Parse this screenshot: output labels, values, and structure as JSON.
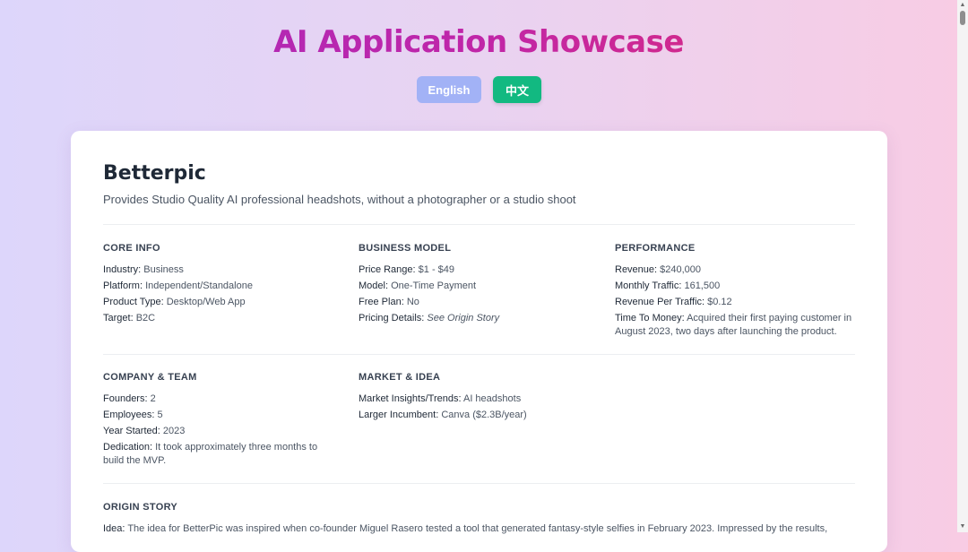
{
  "header": {
    "title": "AI Application Showcase",
    "lang_buttons": [
      "English",
      "中文"
    ],
    "colors": {
      "title_gradient_start": "#a42bc0",
      "title_gradient_end": "#e52d6d",
      "english": "#a2b2f6",
      "chinese": "#12b981"
    }
  },
  "app": {
    "name": "Betterpic",
    "description": "Provides Studio Quality AI professional headshots, without a photographer or a studio shoot"
  },
  "core_info": {
    "heading": "CORE INFO",
    "rows": [
      {
        "key": "Industry:",
        "value": "Business"
      },
      {
        "key": "Platform:",
        "value": "Independent/Standalone"
      },
      {
        "key": "Product Type:",
        "value": "Desktop/Web App"
      },
      {
        "key": "Target:",
        "value": "B2C"
      }
    ]
  },
  "business_model": {
    "heading": "BUSINESS MODEL",
    "rows": [
      {
        "key": "Price Range:",
        "value": "$1 - $49"
      },
      {
        "key": "Model:",
        "value": "One-Time Payment"
      },
      {
        "key": "Free Plan:",
        "value": "No"
      },
      {
        "key": "Pricing Details:",
        "value": "See Origin Story"
      }
    ]
  },
  "performance": {
    "heading": "PERFORMANCE",
    "rows": [
      {
        "key": "Revenue:",
        "value": "$240,000"
      },
      {
        "key": "Monthly Traffic:",
        "value": "161,500"
      },
      {
        "key": "Revenue Per Traffic:",
        "value": "$0.12"
      },
      {
        "key": "Time To Money:",
        "value": "Acquired their first paying customer in August 2023, two days after launching the product."
      }
    ]
  },
  "company_team": {
    "heading": "COMPANY & TEAM",
    "rows": [
      {
        "key": "Founders:",
        "value": "2"
      },
      {
        "key": "Employees:",
        "value": "5"
      },
      {
        "key": "Year Started:",
        "value": "2023"
      },
      {
        "key": "Dedication:",
        "value": "It took approximately three months to build the MVP."
      }
    ]
  },
  "market_idea": {
    "heading": "MARKET & IDEA",
    "rows": [
      {
        "key": "Market Insights/Trends:",
        "value": "AI headshots"
      },
      {
        "key": "Larger Incumbent:",
        "value": "Canva ($2.3B/year)"
      }
    ]
  },
  "origin_story": {
    "heading": "ORIGIN STORY",
    "idea_key": "Idea:",
    "idea_value": "The idea for BetterPic was inspired when co-founder Miguel Rasero tested a tool that generated fantasy-style selfies in February 2023. Impressed by the results,"
  },
  "scrollbar": {
    "up": "▲",
    "down": "▼"
  }
}
